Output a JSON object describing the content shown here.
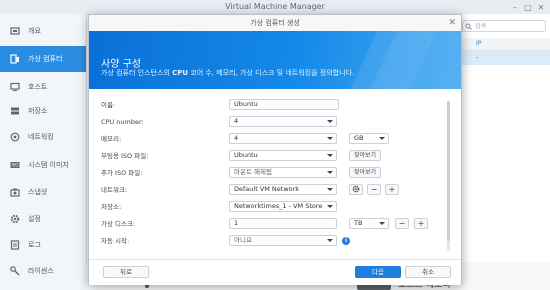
{
  "app": {
    "title": "Virtual Machine Manager"
  },
  "sidebar": {
    "items": [
      {
        "label": "개요",
        "icon": "overview-icon"
      },
      {
        "label": "가상 컴퓨터",
        "icon": "vm-icon",
        "active": true
      },
      {
        "label": "호스트",
        "icon": "host-icon"
      },
      {
        "label": "저장소",
        "icon": "storage-icon"
      },
      {
        "label": "네트워킹",
        "icon": "network-icon"
      },
      {
        "label": "시스템 이미지",
        "icon": "image-icon"
      },
      {
        "label": "스냅샷",
        "icon": "snapshot-icon"
      },
      {
        "label": "설정",
        "icon": "gear-icon"
      },
      {
        "label": "로그",
        "icon": "log-icon"
      },
      {
        "label": "라이센스",
        "icon": "key-icon"
      }
    ]
  },
  "background": {
    "search_placeholder": "검색",
    "table_header_ip": "IP",
    "row_ip": "-",
    "host_memory_label": "호스트 메모리"
  },
  "dialog": {
    "title": "가상 컴퓨터 생성",
    "banner_title": "사양 구성",
    "banner_subtitle_pre": "가상 컴퓨터 인스턴스의 ",
    "banner_subtitle_bold": "CPU",
    "banner_subtitle_post": " 코어 수, 메모리, 가상 디스크 및 네트워킹을 정의합니다.",
    "fields": {
      "name": {
        "label": "이름:",
        "value": "Ubuntu"
      },
      "cpu": {
        "label": "CPU number:",
        "value": "4"
      },
      "memory": {
        "label": "메모리:",
        "value": "4",
        "unit": "GB"
      },
      "boot_iso": {
        "label": "부팅용 ISO 파일:",
        "value": "Ubuntu",
        "button": "찾아보기"
      },
      "extra_iso": {
        "label": "추가 ISO 파일:",
        "value": "마운트 해제됨",
        "button": "찾아보기"
      },
      "network": {
        "label": "네트워크:",
        "value": "Default VM Network"
      },
      "storage": {
        "label": "저장소:",
        "value": "Networktimes_1 - VM Store"
      },
      "disk": {
        "label": "가상 디스크:",
        "value": "1",
        "unit": "TB"
      },
      "autostart": {
        "label": "자동 시작:",
        "value": "아니요"
      }
    },
    "buttons": {
      "back": "뒤로",
      "next": "다음",
      "cancel": "취소"
    }
  },
  "colors": {
    "accent": "#1b7fdc",
    "sidebar_active": "#2b8de1",
    "banner": "#0a6fd8"
  }
}
